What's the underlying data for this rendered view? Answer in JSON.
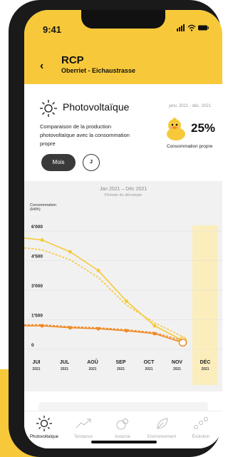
{
  "status_bar": {
    "time": "9:41",
    "icons": "📶 ◉ ▬"
  },
  "header": {
    "back": "‹",
    "title": "RCP",
    "subtitle": "Oberriet - Eichaustrasse"
  },
  "card": {
    "title": "Photovoltaïque",
    "period": "janv. 2021 - déc. 2021",
    "description": "Comparaison de la production photovoltaïque avec la consommation propre",
    "percent": "25%",
    "percent_label": "Consommation propre",
    "icon": "sun-icon",
    "mascot": "duck-icon"
  },
  "controls": {
    "mois": "Mois",
    "j": "J"
  },
  "colors": {
    "accent": "#f7c93a",
    "line_main": "#f7c93a",
    "line_orange": "#f08a24",
    "highlight": "#fbeebc"
  },
  "chart_data": {
    "type": "line",
    "title": "Jan 2021 – Déc 2021",
    "subtitle": "Période du décompte",
    "ylabel": "Consommation (kWh)",
    "ylim": [
      0,
      6000
    ],
    "yticks": [
      "6'000",
      "4'500",
      "3'000",
      "1'500",
      "0"
    ],
    "ytick_values": [
      6000,
      4500,
      3000,
      1500,
      0
    ],
    "categories": [
      "JUI",
      "JUL",
      "AOÛ",
      "SEP",
      "OCT",
      "NOV",
      "DÉC"
    ],
    "category_years": [
      "2021",
      "2021",
      "2021",
      "2021",
      "2021",
      "2021",
      "2021"
    ],
    "highlighted_category": "DÉC",
    "x_start_value": 5500,
    "series": [
      {
        "style": "solid",
        "color": "#f7c93a",
        "values": [
          5400,
          4800,
          3850,
          2300,
          1050,
          300
        ]
      },
      {
        "style": "dashed",
        "color": "#f7c93a",
        "values": [
          4900,
          4400,
          3500,
          2100,
          1200,
          500
        ]
      },
      {
        "style": "solid",
        "color": "#f08a24",
        "values": [
          1050,
          950,
          900,
          800,
          650,
          200
        ]
      },
      {
        "style": "dashed",
        "color": "#f08a24",
        "values": [
          1100,
          1000,
          950,
          850,
          700,
          300
        ]
      }
    ]
  },
  "tabs": [
    {
      "label": "Photovoltaïque",
      "icon": "sun-icon",
      "active": true
    },
    {
      "label": "Tendance",
      "icon": "trend-icon",
      "active": false
    },
    {
      "label": "Autarcie",
      "icon": "autarky-icon",
      "active": false
    },
    {
      "label": "Environnement",
      "icon": "leaf-icon",
      "active": false
    },
    {
      "label": "Évolution",
      "icon": "evolution-icon",
      "active": false
    }
  ]
}
